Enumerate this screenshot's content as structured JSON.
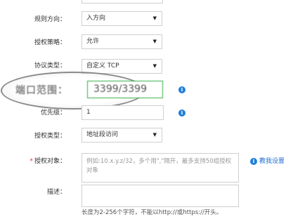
{
  "form": {
    "direction": {
      "label": "规则方向：",
      "value": "入方向"
    },
    "policy": {
      "label": "授权策略：",
      "value": "允许"
    },
    "protocol": {
      "label": "协议类型：",
      "value": "自定义 TCP"
    },
    "port": {
      "label": "端口范围：",
      "value": "3399/3399"
    },
    "priority": {
      "label": "优先级：",
      "value": "1"
    },
    "auth_type": {
      "label": "授权类型：",
      "value": "地址段访问"
    },
    "auth_object": {
      "required_mark": "*",
      "label": "授权对象：",
      "placeholder": "例如:10.x.y.z/32，多个用\",\"隔开，最多支持50组授权对象"
    },
    "tutorial_link": "教我设置",
    "description": {
      "label": "描述：",
      "hint": "长度为2-256个字符，不能以http://或https://开头。"
    }
  },
  "icons": {
    "dropdown": "dropdown-arrow-icon",
    "info": "info-icon",
    "info_color": "#1f7fd8"
  },
  "colors": {
    "port_input_border": "#2eaa3a",
    "link": "#1f6fd0",
    "required": "#e0301e"
  }
}
